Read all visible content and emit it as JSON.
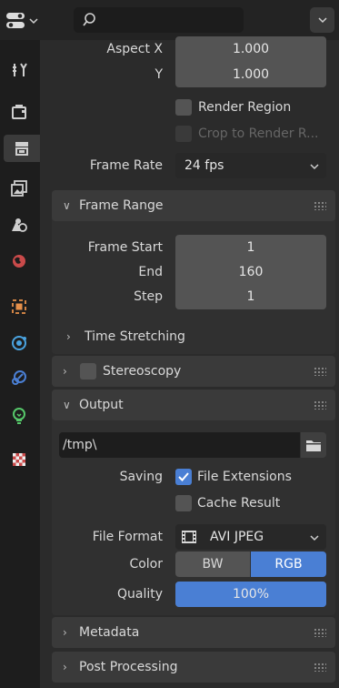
{
  "toolbar": {
    "search_placeholder": "",
    "editor_icon": "properties-editor-icon",
    "options_icon": "chevron-down-icon"
  },
  "sidebar": {
    "tabs": [
      {
        "name": "tool",
        "icon": "tool-icon"
      },
      {
        "name": "render",
        "icon": "render-icon"
      },
      {
        "name": "output",
        "icon": "output-icon",
        "active": true
      },
      {
        "name": "view-layer",
        "icon": "view-layer-icon"
      },
      {
        "name": "scene",
        "icon": "scene-icon"
      },
      {
        "name": "world",
        "icon": "world-icon"
      },
      {
        "name": "object",
        "icon": "object-icon"
      },
      {
        "name": "physics",
        "icon": "physics-icon"
      },
      {
        "name": "constraints",
        "icon": "constraints-icon"
      },
      {
        "name": "data",
        "icon": "bulb-icon"
      },
      {
        "name": "texture",
        "icon": "texture-icon"
      }
    ]
  },
  "format": {
    "aspect_x_label": "Aspect X",
    "aspect_x": "1.000",
    "aspect_y_label": "Y",
    "aspect_y": "1.000",
    "render_region": "Render Region",
    "crop_to_render": "Crop to Render R...",
    "frame_rate_label": "Frame Rate",
    "frame_rate": "24 fps"
  },
  "frame_range": {
    "title": "Frame Range",
    "start_label": "Frame Start",
    "start": "1",
    "end_label": "End",
    "end": "160",
    "step_label": "Step",
    "step": "1",
    "time_stretching": "Time Stretching"
  },
  "stereoscopy": {
    "title": "Stereoscopy"
  },
  "output": {
    "title": "Output",
    "path": "/tmp\\",
    "saving_label": "Saving",
    "file_extensions": "File Extensions",
    "file_extensions_checked": true,
    "cache_result": "Cache Result",
    "cache_result_checked": false,
    "file_format_label": "File Format",
    "file_format": "AVI JPEG",
    "color_label": "Color",
    "color_options": [
      "BW",
      "RGB"
    ],
    "color_selected": "RGB",
    "quality_label": "Quality",
    "quality": "100%",
    "quality_fraction": 1.0
  },
  "metadata": {
    "title": "Metadata"
  },
  "post_processing": {
    "title": "Post Processing"
  },
  "colors": {
    "accent": "#4a7fd4",
    "field": "#545454",
    "panel": "#303030",
    "header": "#3a3a3a"
  }
}
